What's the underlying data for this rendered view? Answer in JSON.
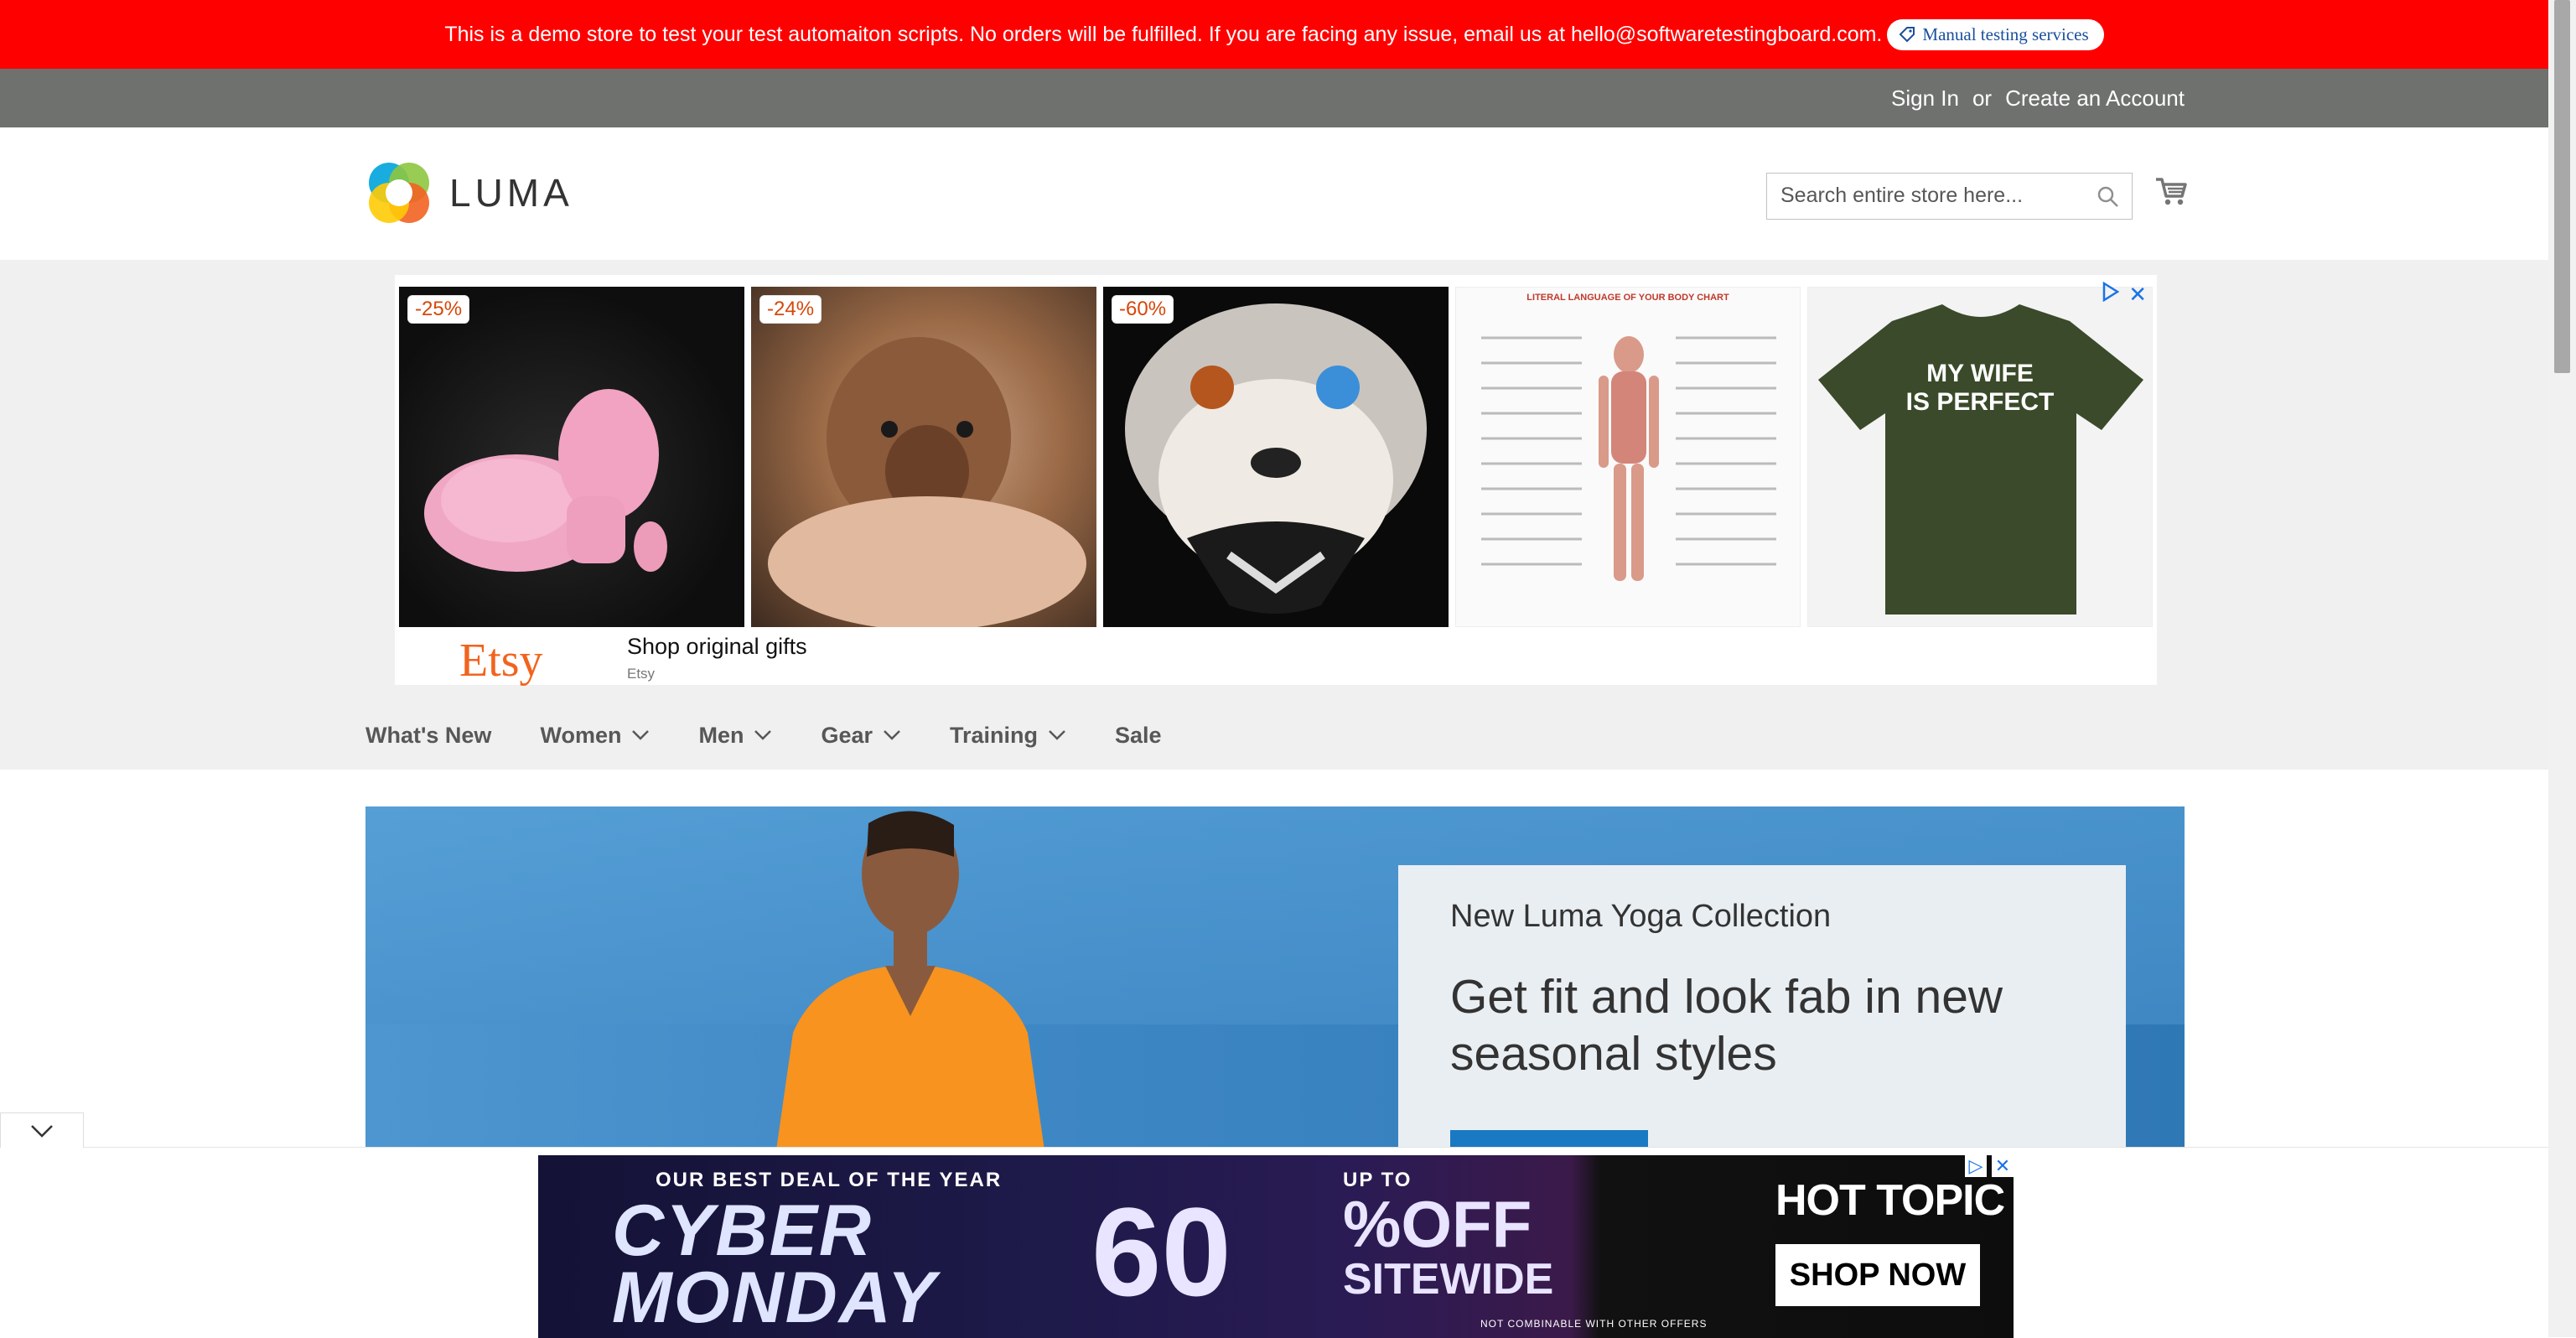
{
  "notice": {
    "message": "This is a demo store to test your test automaiton scripts. No orders will be fulfilled. If you are facing any issue, email us at hello@softwaretestingboard.com.",
    "pill_label": "Manual testing services"
  },
  "top_links": {
    "sign_in": "Sign In",
    "or": "or",
    "create_account": "Create an Account"
  },
  "header": {
    "logo_text": "LUMA",
    "search_placeholder": "Search entire store here..."
  },
  "ad": {
    "tiles": [
      {
        "discount": "-25%"
      },
      {
        "discount": "-24%"
      },
      {
        "discount": "-60%"
      }
    ],
    "chart_title": "LITERAL LANGUAGE OF YOUR BODY CHART",
    "tshirt_text_1": "MY WIFE",
    "tshirt_text_2": "IS PERFECT",
    "advertiser": "Etsy",
    "headline": "Shop original gifts",
    "source": "Etsy",
    "close_glyph": "✕"
  },
  "nav": {
    "items": [
      {
        "label": "What's New",
        "has_menu": false
      },
      {
        "label": "Women",
        "has_menu": true
      },
      {
        "label": "Men",
        "has_menu": true
      },
      {
        "label": "Gear",
        "has_menu": true
      },
      {
        "label": "Training",
        "has_menu": true
      },
      {
        "label": "Sale",
        "has_menu": false
      }
    ]
  },
  "hero": {
    "kicker": "New Luma Yoga Collection",
    "headline": "Get fit and look fab in new seasonal styles"
  },
  "bottom_ad": {
    "deal_line": "OUR BEST DEAL OF THE YEAR",
    "cyber": "CYBER",
    "monday": "MONDAY",
    "up_to": "UP TO",
    "sixty": "60",
    "percent_off": "%OFF",
    "sitewide": "SITEWIDE",
    "fine_print": "NOT COMBINABLE WITH OTHER OFFERS",
    "brand": "HOT TOPIC",
    "cta": "SHOP NOW"
  },
  "colors": {
    "notice_bg": "#ff0000",
    "top_panel_bg": "#6e716e",
    "hero_blue": "#3d86c4",
    "button_blue": "#1979c3",
    "etsy_orange": "#f1641e"
  }
}
